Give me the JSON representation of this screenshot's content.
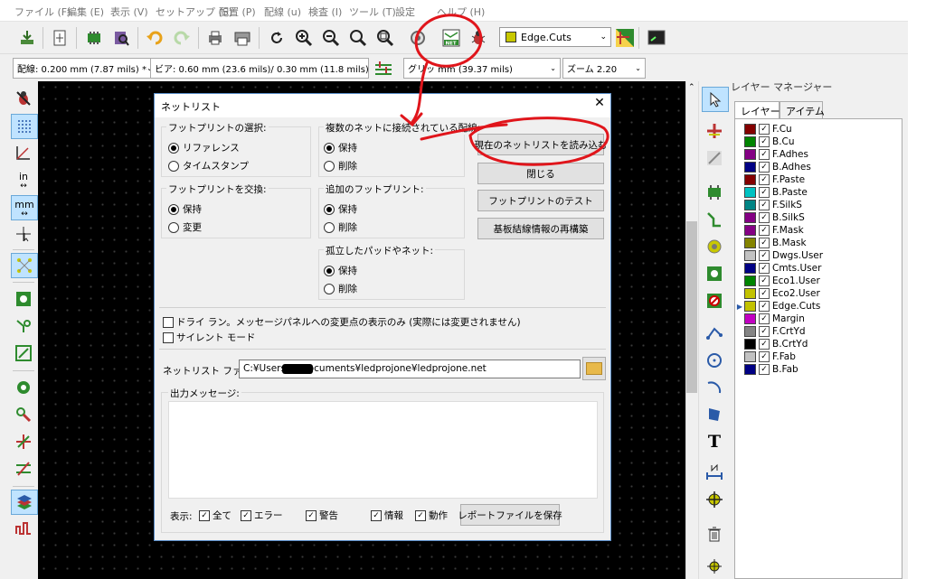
{
  "menu": [
    "ファイル (F)",
    "編集 (E)",
    "表示 (V)",
    "セットアップ (S)",
    "配置 (P)",
    "配線 (u)",
    "検査 (I)",
    "ツール (T)",
    "設定",
    "ヘルプ (H)"
  ],
  "toolbar": {
    "layer_select": "Edge.Cuts",
    "icons": [
      "download-icon",
      "page-settings-icon",
      "footprint-library-icon",
      "footprint-browser-icon",
      "undo-icon",
      "redo-icon",
      "print-icon",
      "plot-icon",
      "refresh-icon",
      "zoom-in-icon",
      "zoom-out-icon",
      "zoom-fit-icon",
      "zoom-selection-icon",
      "find-icon",
      "netlist-icon",
      "drc-bug-icon",
      "layer-pair-icon",
      "scripting-icon"
    ]
  },
  "toolbar2": {
    "track": "配線: 0.200 mm (7.87 mils) *",
    "via": "ビア: 0.60 mm (23.6 mils)/ 0.30 mm (11.8 mils) *",
    "grid": "グリッ        mm (39.37 mils)",
    "zoom": "ズーム 2.20"
  },
  "left_toolbar": {
    "icons": [
      "drc-off-icon",
      "grid-icon",
      "polar-coords-icon",
      "inch-units-icon",
      "mm-units-icon",
      "cursor-shape-icon",
      "ratsnest-icon",
      "zone-fill-icon",
      "zone-outline-icon",
      "zone-sketch-icon",
      "pad-sketch-icon",
      "via-sketch-icon",
      "track-sketch-icon",
      "high-contrast-icon",
      "layers-manager-icon",
      "microwave-icon"
    ],
    "in_label": "in",
    "mm_label": "mm"
  },
  "right_toolbar": {
    "icons": [
      "select-arrow-icon",
      "highlight-net-icon",
      "local-ratsnest-icon",
      "add-footprint-icon",
      "route-track-icon",
      "add-via-icon",
      "add-zone-icon",
      "keepout-area-icon",
      "add-line-icon",
      "add-circle-icon",
      "add-arc-icon",
      "add-polygon-icon",
      "add-text-icon",
      "add-dimension-icon",
      "add-target-icon",
      "delete-icon",
      "grid-origin-icon"
    ],
    "text_tool": "T"
  },
  "layer_manager": {
    "title": "レイヤー マネージャー",
    "tabs": [
      "レイヤー",
      "アイテム"
    ],
    "active_layer": "Edge.Cuts",
    "layers": [
      {
        "name": "F.Cu",
        "color": "#840000"
      },
      {
        "name": "B.Cu",
        "color": "#008400"
      },
      {
        "name": "F.Adhes",
        "color": "#840084"
      },
      {
        "name": "B.Adhes",
        "color": "#000084"
      },
      {
        "name": "F.Paste",
        "color": "#840000"
      },
      {
        "name": "B.Paste",
        "color": "#00c2c2"
      },
      {
        "name": "F.SilkS",
        "color": "#008484"
      },
      {
        "name": "B.SilkS",
        "color": "#840084"
      },
      {
        "name": "F.Mask",
        "color": "#840084"
      },
      {
        "name": "B.Mask",
        "color": "#848400"
      },
      {
        "name": "Dwgs.User",
        "color": "#c2c2c2"
      },
      {
        "name": "Cmts.User",
        "color": "#000084"
      },
      {
        "name": "Eco1.User",
        "color": "#008400"
      },
      {
        "name": "Eco2.User",
        "color": "#c2c200"
      },
      {
        "name": "Edge.Cuts",
        "color": "#c2c200"
      },
      {
        "name": "Margin",
        "color": "#c200c2"
      },
      {
        "name": "F.CrtYd",
        "color": "#848484"
      },
      {
        "name": "B.CrtYd",
        "color": "#000000"
      },
      {
        "name": "F.Fab",
        "color": "#c2c2c2"
      },
      {
        "name": "B.Fab",
        "color": "#000084"
      }
    ]
  },
  "dialog": {
    "title": "ネットリスト",
    "footprint_select": {
      "label": "フットプリントの選択:",
      "options": [
        "リファレンス",
        "タイムスタンプ"
      ],
      "selected": 0
    },
    "exchange_footprint": {
      "label": "フットプリントを交換:",
      "options": [
        "保持",
        "変更"
      ],
      "selected": 0
    },
    "multi_net_tracks": {
      "label": "複数のネットに接続されている配線:",
      "options": [
        "保持",
        "削除"
      ],
      "selected": 0
    },
    "extra_footprints": {
      "label": "追加のフットプリント:",
      "options": [
        "保持",
        "削除"
      ],
      "selected": 0
    },
    "isolated_pads": {
      "label": "孤立したパッドやネット:",
      "options": [
        "保持",
        "削除"
      ],
      "selected": 0
    },
    "buttons": {
      "read_netlist": "現在のネットリストを読み込む",
      "close": "閉じる",
      "test_footprints": "フットプリントのテスト",
      "rebuild_ratsnest": "基板結線情報の再構築"
    },
    "dry_run": "ドライ ラン。メッセージパネルへの変更点の表示のみ (実際には変更されません)",
    "silent_mode": "サイレント モード",
    "netlist_file_label": "ネットリスト ファイル:",
    "netlist_path": "C:¥Users¥        ¥Documents¥ledprojone¥ledprojone.net",
    "output_label": "出力メッセージ:",
    "show_label": "表示:",
    "filters": [
      {
        "label": "全て",
        "checked": true
      },
      {
        "label": "エラー",
        "checked": true
      },
      {
        "label": "警告",
        "checked": true
      },
      {
        "label": "情報",
        "checked": true
      },
      {
        "label": "動作",
        "checked": true
      }
    ],
    "save_report": "レポートファイルを保存"
  },
  "annotation_color": "#e0151b"
}
